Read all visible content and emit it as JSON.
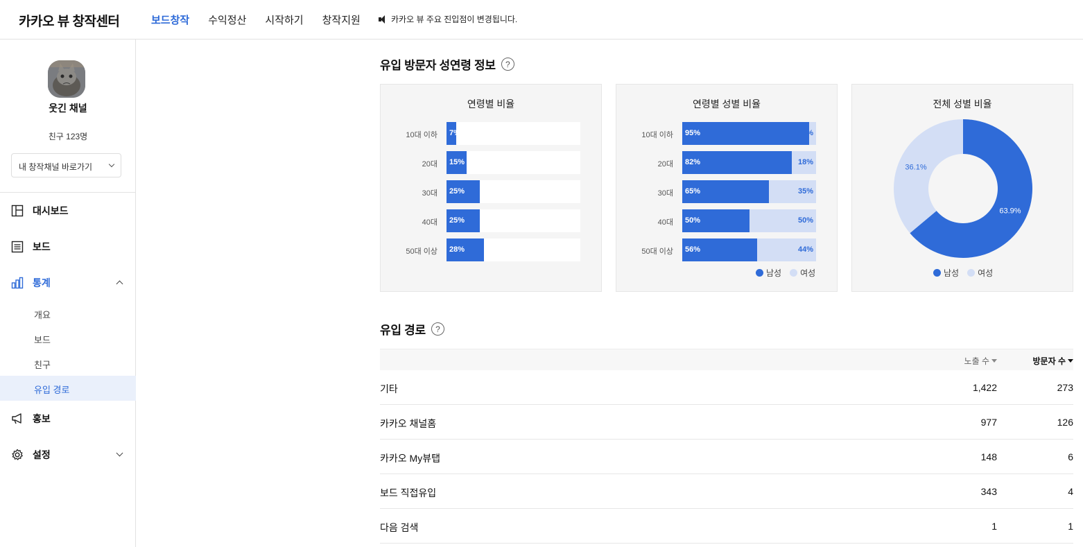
{
  "header": {
    "brand": "카카오 뷰 창작센터",
    "nav": [
      "보드창작",
      "수익정산",
      "시작하기",
      "창작지원"
    ],
    "notice": "카카오 뷰 주요 진입점이 변경됩니다."
  },
  "sidebar": {
    "channel_name": "웃긴 채널",
    "friends": "친구 123명",
    "channel_select": "내 창작채널 바로가기",
    "menu": {
      "dashboard": "대시보드",
      "board": "보드",
      "stats": "통계",
      "promo": "홍보",
      "settings": "설정"
    },
    "stats_sub": [
      "개요",
      "보드",
      "친구",
      "유입 경로"
    ]
  },
  "section1": {
    "title": "유입 방문자 성연령 정보",
    "help": "?"
  },
  "section2": {
    "title": "유입 경로",
    "help": "?"
  },
  "colors": {
    "accent": "#2f6bd8",
    "male": "#2f6bd8",
    "female": "#d3def5"
  },
  "chart_data": [
    {
      "type": "bar",
      "title": "연령별 비율",
      "categories": [
        "10대 이하",
        "20대",
        "30대",
        "40대",
        "50대 이상"
      ],
      "values": [
        7,
        15,
        25,
        25,
        28
      ],
      "labels": [
        "7%",
        "15%",
        "25%",
        "25%",
        "28%"
      ],
      "ylim": [
        0,
        100
      ]
    },
    {
      "type": "bar",
      "title": "연령별 성별 비율",
      "categories": [
        "10대 이하",
        "20대",
        "30대",
        "40대",
        "50대 이상"
      ],
      "series": [
        {
          "name": "남성",
          "values": [
            95,
            82,
            65,
            50,
            56
          ],
          "labels": [
            "95%",
            "82%",
            "65%",
            "50%",
            "56%"
          ]
        },
        {
          "name": "여성",
          "values": [
            5,
            18,
            35,
            50,
            44
          ],
          "labels": [
            "5%",
            "18%",
            "35%",
            "50%",
            "44%"
          ]
        }
      ],
      "legend": [
        "남성",
        "여성"
      ]
    },
    {
      "type": "pie",
      "title": "전체 성별 비율",
      "categories": [
        "남성",
        "여성"
      ],
      "values": [
        63.9,
        36.1
      ],
      "labels": [
        "63.9%",
        "36.1%"
      ],
      "legend": [
        "남성",
        "여성"
      ]
    }
  ],
  "table": {
    "headers": {
      "impressions": "노출 수",
      "visitors": "방문자 수"
    },
    "rows": [
      {
        "name": "기타",
        "impressions": "1,422",
        "visitors": "273"
      },
      {
        "name": "카카오 채널홈",
        "impressions": "977",
        "visitors": "126"
      },
      {
        "name": "카카오 My뷰탭",
        "impressions": "148",
        "visitors": "6"
      },
      {
        "name": "보드 직접유입",
        "impressions": "343",
        "visitors": "4"
      },
      {
        "name": "다음 검색",
        "impressions": "1",
        "visitors": "1"
      }
    ]
  }
}
